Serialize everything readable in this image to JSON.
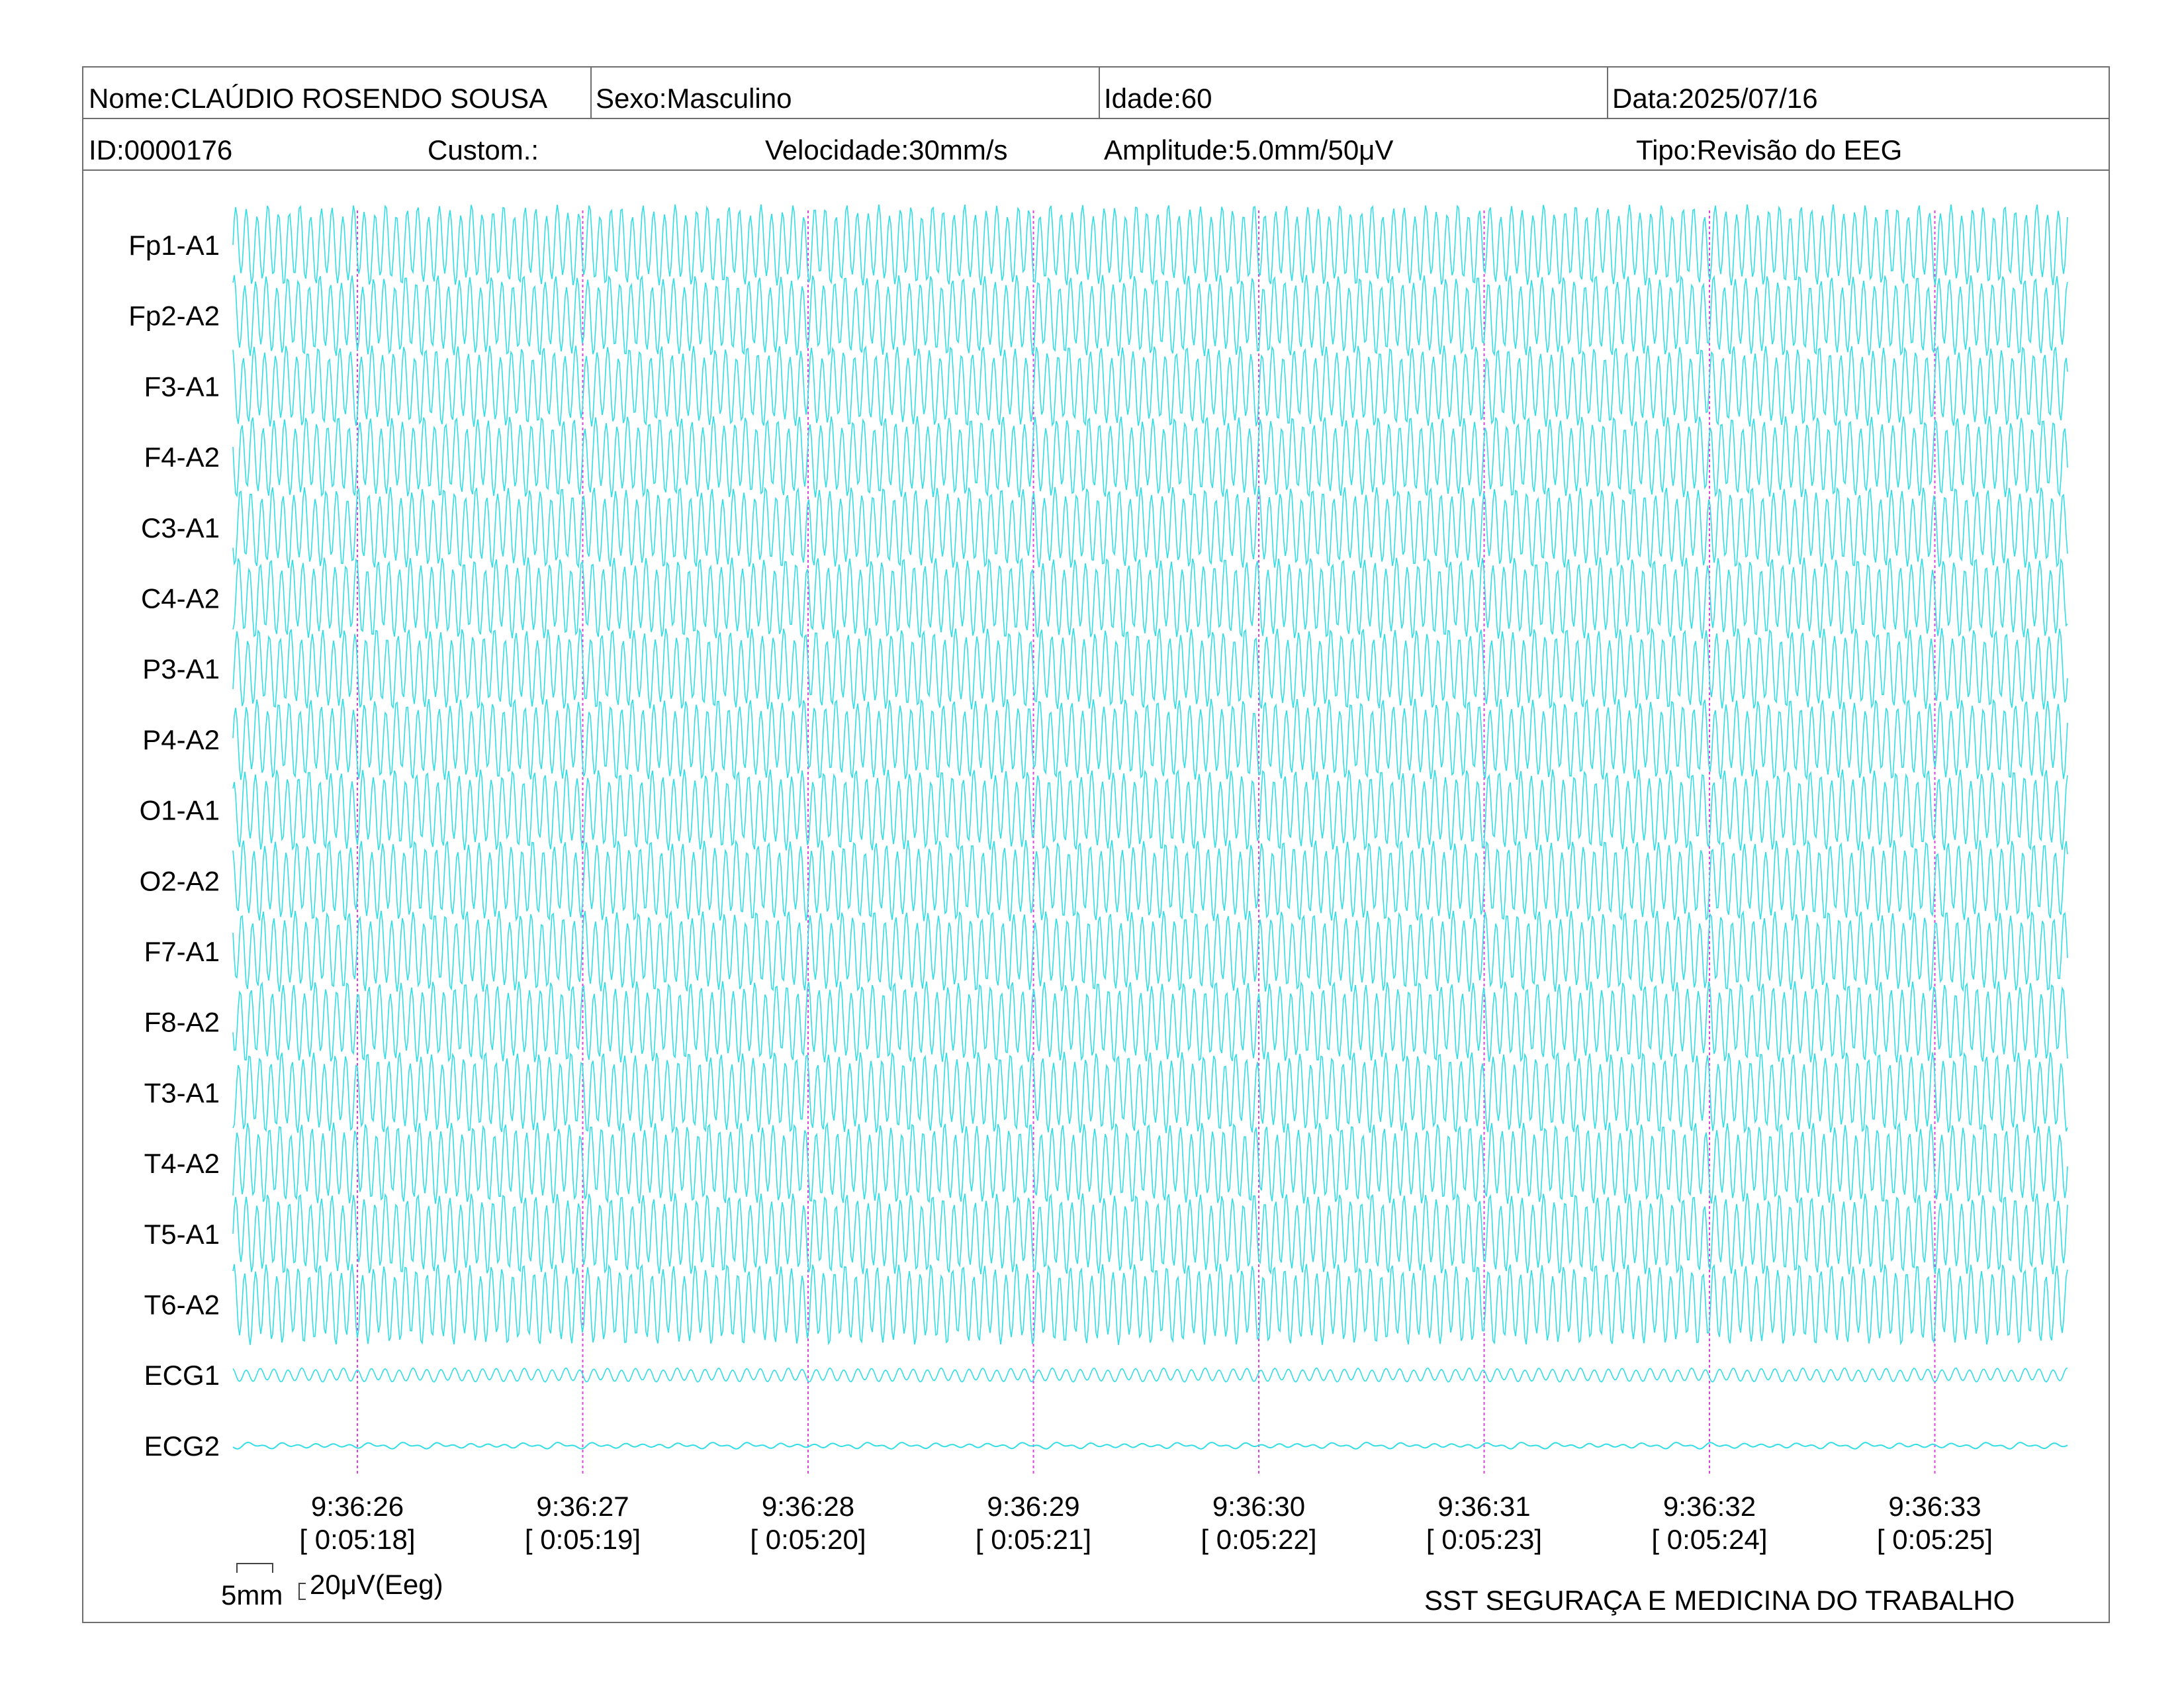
{
  "header": {
    "nome": "Nome:CLAÚDIO ROSENDO SOUSA",
    "sexo": "Sexo:Masculino",
    "idade": "Idade:60",
    "data": "Data:2025/07/16",
    "id": "ID:0000176",
    "custom": "Custom.:",
    "velocidade": "Velocidade:30mm/s",
    "amplitude": "Amplitude:5.0mm/50μV",
    "tipo": "Tipo:Revisão do EEG"
  },
  "chart_data": {
    "type": "line",
    "channels": [
      "Fp1-A1",
      "Fp2-A2",
      "F3-A1",
      "F4-A2",
      "C3-A1",
      "C4-A2",
      "P3-A1",
      "P4-A2",
      "O1-A1",
      "O2-A2",
      "F7-A1",
      "F8-A2",
      "T3-A1",
      "T4-A2",
      "T5-A1",
      "T6-A2",
      "ECG1",
      "ECG2"
    ],
    "time_marks": [
      {
        "clock": "9:36:26",
        "elapsed": "[ 0:05:18]"
      },
      {
        "clock": "9:36:27",
        "elapsed": "[ 0:05:19]"
      },
      {
        "clock": "9:36:28",
        "elapsed": "[ 0:05:20]"
      },
      {
        "clock": "9:36:29",
        "elapsed": "[ 0:05:21]"
      },
      {
        "clock": "9:36:30",
        "elapsed": "[ 0:05:22]"
      },
      {
        "clock": "9:36:31",
        "elapsed": "[ 0:05:23]"
      },
      {
        "clock": "9:36:32",
        "elapsed": "[ 0:05:24]"
      },
      {
        "clock": "9:36:33",
        "elapsed": "[ 0:05:25]"
      }
    ],
    "trace_color": "#33dde6",
    "marker_color": "#e040e0"
  },
  "footer": {
    "scale_time": "5mm",
    "scale_amp": "20μV(Eeg)",
    "company": "SST SEGURAÇA E MEDICINA DO TRABALHO"
  }
}
